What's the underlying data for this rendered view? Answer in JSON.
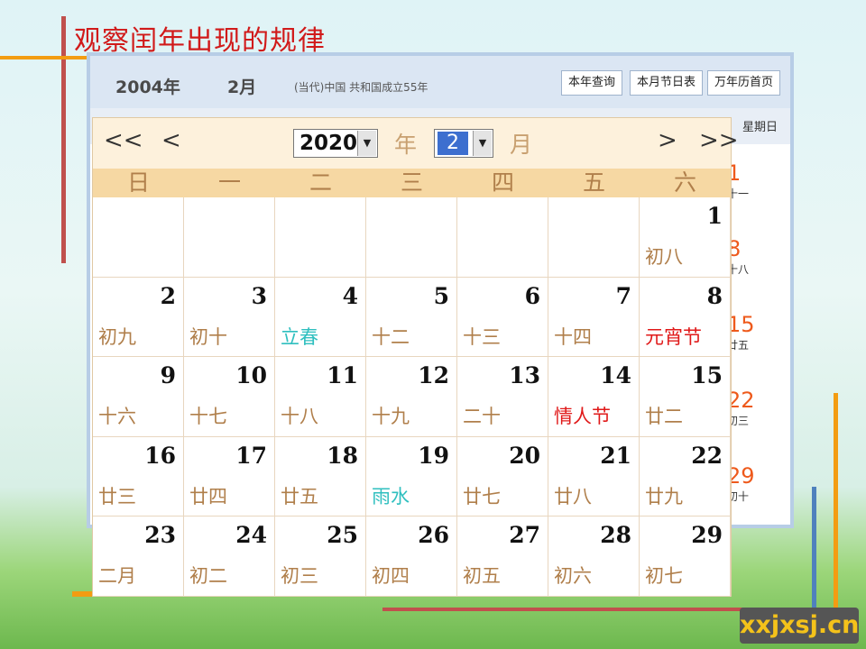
{
  "slide": {
    "title": "观察闰年出现的规律"
  },
  "old_calendar": {
    "year": "2004年",
    "month": "2月",
    "era": "(当代)中国 共和国成立55年",
    "buttons": [
      "本年查询",
      "本月节日表",
      "万年历首页"
    ],
    "sunday_header": "星期日",
    "sundays": [
      {
        "day": "1",
        "lunar": "十一"
      },
      {
        "day": "8",
        "lunar": "十八"
      },
      {
        "day": "15",
        "lunar": "廿五"
      },
      {
        "day": "22",
        "lunar": "初三"
      },
      {
        "day": "29",
        "lunar": "初十"
      }
    ]
  },
  "calendar": {
    "nav": {
      "prev_year": "<<",
      "prev_month": "<",
      "next_month": ">",
      "next_year": ">>"
    },
    "year_value": "2020",
    "year_label": "年",
    "month_value": "2",
    "month_label": "月",
    "weekdays": [
      "日",
      "一",
      "二",
      "三",
      "四",
      "五",
      "六"
    ],
    "days": [
      {
        "day": "",
        "lunar": "",
        "type": ""
      },
      {
        "day": "",
        "lunar": "",
        "type": ""
      },
      {
        "day": "",
        "lunar": "",
        "type": ""
      },
      {
        "day": "",
        "lunar": "",
        "type": ""
      },
      {
        "day": "",
        "lunar": "",
        "type": ""
      },
      {
        "day": "",
        "lunar": "",
        "type": ""
      },
      {
        "day": "1",
        "lunar": "初八",
        "type": ""
      },
      {
        "day": "2",
        "lunar": "初九",
        "type": ""
      },
      {
        "day": "3",
        "lunar": "初十",
        "type": ""
      },
      {
        "day": "4",
        "lunar": "立春",
        "type": "term"
      },
      {
        "day": "5",
        "lunar": "十二",
        "type": ""
      },
      {
        "day": "6",
        "lunar": "十三",
        "type": ""
      },
      {
        "day": "7",
        "lunar": "十四",
        "type": ""
      },
      {
        "day": "8",
        "lunar": "元宵节",
        "type": "fest"
      },
      {
        "day": "9",
        "lunar": "十六",
        "type": ""
      },
      {
        "day": "10",
        "lunar": "十七",
        "type": ""
      },
      {
        "day": "11",
        "lunar": "十八",
        "type": ""
      },
      {
        "day": "12",
        "lunar": "十九",
        "type": ""
      },
      {
        "day": "13",
        "lunar": "二十",
        "type": ""
      },
      {
        "day": "14",
        "lunar": "情人节",
        "type": "fest"
      },
      {
        "day": "15",
        "lunar": "廿二",
        "type": ""
      },
      {
        "day": "16",
        "lunar": "廿三",
        "type": ""
      },
      {
        "day": "17",
        "lunar": "廿四",
        "type": ""
      },
      {
        "day": "18",
        "lunar": "廿五",
        "type": ""
      },
      {
        "day": "19",
        "lunar": "雨水",
        "type": "term"
      },
      {
        "day": "20",
        "lunar": "廿七",
        "type": ""
      },
      {
        "day": "21",
        "lunar": "廿八",
        "type": ""
      },
      {
        "day": "22",
        "lunar": "廿九",
        "type": ""
      },
      {
        "day": "23",
        "lunar": "二月",
        "type": ""
      },
      {
        "day": "24",
        "lunar": "初二",
        "type": ""
      },
      {
        "day": "25",
        "lunar": "初三",
        "type": ""
      },
      {
        "day": "26",
        "lunar": "初四",
        "type": ""
      },
      {
        "day": "27",
        "lunar": "初五",
        "type": ""
      },
      {
        "day": "28",
        "lunar": "初六",
        "type": ""
      },
      {
        "day": "29",
        "lunar": "初七",
        "type": ""
      }
    ]
  },
  "watermark": "xxjxsj.cn",
  "colors": {
    "title": "#d11a1a",
    "festival": "#e01919",
    "solar_term": "#2fbfbf",
    "lunar": "#b07f4b",
    "sunday": "#ee5a1c"
  }
}
